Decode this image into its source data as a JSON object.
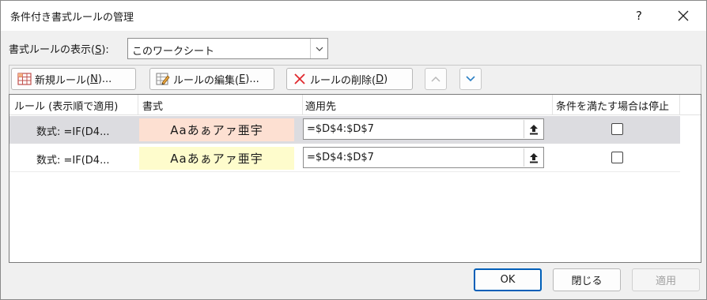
{
  "window": {
    "title": "条件付き書式ルールの管理",
    "help_label": "?"
  },
  "scope": {
    "label_prefix": "書式ルールの表示(",
    "label_key": "S",
    "label_suffix": "):",
    "selected": "このワークシート"
  },
  "toolbar": {
    "new_rule": {
      "prefix": "新規ルール(",
      "key": "N",
      "suffix": ")..."
    },
    "edit_rule": {
      "prefix": "ルールの編集(",
      "key": "E",
      "suffix": ")..."
    },
    "delete_rule": {
      "prefix": "ルールの削除(",
      "key": "D",
      "suffix": ")"
    }
  },
  "table": {
    "headers": [
      "ルール (表示順で適用)",
      "書式",
      "適用先",
      "条件を満たす場合は停止"
    ],
    "rows": [
      {
        "rule": "数式: =IF(D4...",
        "preview": "Aaあぁアァ亜宇",
        "preview_color": "#fde0d2",
        "applies_to": "=$D$4:$D$7",
        "stop_if_true": false,
        "selected": true
      },
      {
        "rule": "数式: =IF(D4...",
        "preview": "Aaあぁアァ亜宇",
        "preview_color": "#fefccc",
        "applies_to": "=$D$4:$D$7",
        "stop_if_true": false,
        "selected": false
      }
    ]
  },
  "footer": {
    "ok": "OK",
    "close": "閉じる",
    "apply": "適用"
  },
  "colors": {
    "accent": "#005fb8",
    "delete_red": "#e0282d",
    "arrow_blue": "#2b7fc4"
  }
}
